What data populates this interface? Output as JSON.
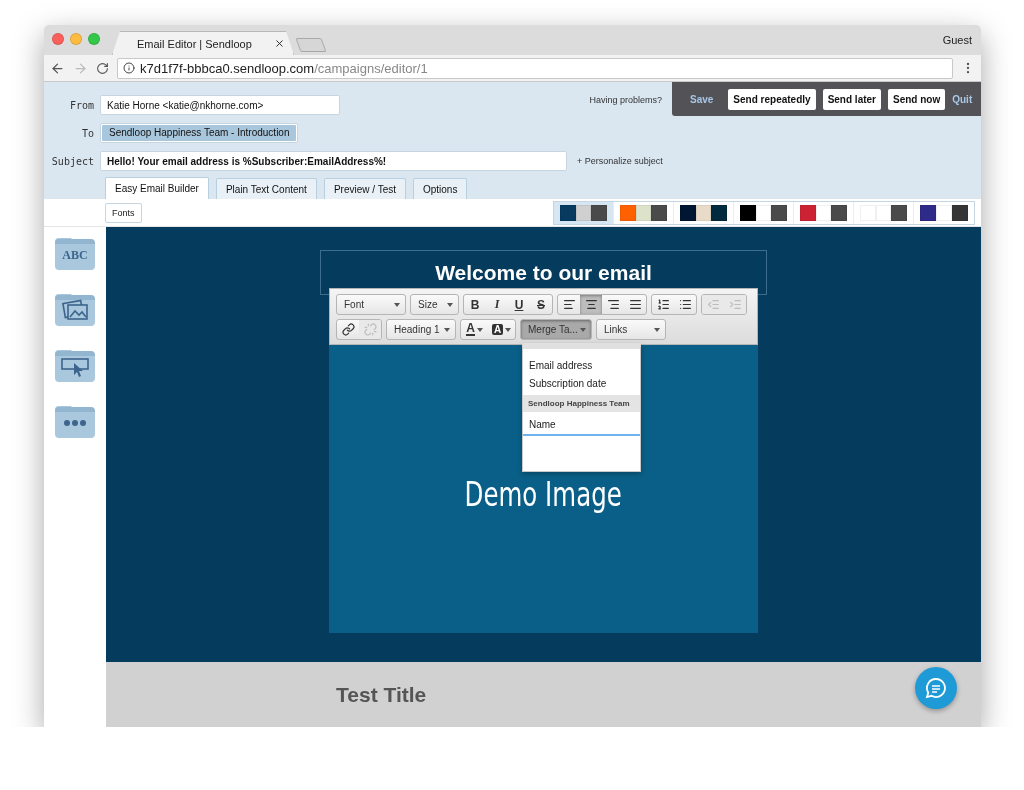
{
  "browser": {
    "tab_title": "Email Editor | Sendloop",
    "profile": "Guest",
    "url_host": "k7d1f7f-bbbca0.sendloop.com",
    "url_path": "/campaigns/editor/1"
  },
  "header": {
    "fields": [
      {
        "label": "From",
        "kind": "text",
        "value": "Katie Horne <katie@nkhorne.com>"
      },
      {
        "label": "To",
        "kind": "chip",
        "value": "Sendloop Happiness Team - Introduction"
      },
      {
        "label": "Subject",
        "kind": "subject",
        "value": "Hello! Your email address is %Subscriber:EmailAddress%!",
        "link": "+ Personalize subject"
      }
    ],
    "help_link": "Having problems?",
    "actions": [
      {
        "label": "Save",
        "kind": "link"
      },
      {
        "label": "Send repeatedly",
        "kind": "button"
      },
      {
        "label": "Send later",
        "kind": "button"
      },
      {
        "label": "Send now",
        "kind": "button"
      },
      {
        "label": "Quit",
        "kind": "link"
      }
    ],
    "tabs": [
      {
        "label": "Easy Email Builder",
        "selected": true
      },
      {
        "label": "Plain Text Content",
        "selected": false
      },
      {
        "label": "Preview / Test",
        "selected": false
      },
      {
        "label": "Options",
        "selected": false
      }
    ]
  },
  "toolbar": {
    "fonts_button": "Fonts",
    "palettes": [
      {
        "selected": true,
        "colors": [
          {
            "color": "#063a5e"
          },
          {
            "color": "#d0d0d0"
          },
          {
            "color": "#4a4a4a"
          }
        ]
      },
      {
        "selected": false,
        "colors": [
          {
            "color": "#ff6000"
          },
          {
            "color": "#dde3cb"
          },
          {
            "color": "#4a4a4a"
          }
        ]
      },
      {
        "selected": false,
        "colors": [
          {
            "color": "#001632"
          },
          {
            "color": "#e8dcc8"
          },
          {
            "color": "#002a3e"
          }
        ]
      },
      {
        "selected": false,
        "colors": [
          {
            "color": "#000000"
          },
          {
            "color": "#ffffff"
          },
          {
            "color": "#4a4a4a"
          }
        ]
      },
      {
        "selected": false,
        "colors": [
          {
            "color": "#cc2233"
          },
          {
            "color": "#ffffff"
          },
          {
            "color": "#4a4a4a"
          }
        ]
      },
      {
        "selected": false,
        "colors": [
          {
            "color": "#ffffff"
          },
          {
            "color": "#ffffff"
          },
          {
            "color": "#4a4a4a"
          }
        ]
      },
      {
        "selected": false,
        "colors": [
          {
            "color": "#2e2a8a"
          },
          {
            "color": "#ffffff"
          },
          {
            "color": "#353535"
          }
        ]
      }
    ]
  },
  "sidebar": [
    {
      "kind": "text",
      "label": "ABC"
    },
    {
      "kind": "image"
    },
    {
      "kind": "button"
    },
    {
      "kind": "more"
    }
  ],
  "editor": {
    "title": "Welcome to our email",
    "image_text": "Demo Image",
    "toolbar_rows": [
      [
        {
          "kind": "dropdown",
          "label": "Font",
          "active": false
        },
        {
          "kind": "dropdown",
          "label": "Size",
          "active": false
        },
        {
          "kind": "group",
          "buttons": [
            {
              "kind": "bold",
              "label": "B",
              "selected": false
            },
            {
              "kind": "italic",
              "label": "I",
              "selected": false
            },
            {
              "kind": "underline",
              "label": "U",
              "selected": false
            },
            {
              "kind": "strike",
              "label": "S",
              "selected": false
            }
          ]
        },
        {
          "kind": "group",
          "buttons": [
            {
              "kind": "align-left",
              "selected": false
            },
            {
              "kind": "align-center",
              "selected": true
            },
            {
              "kind": "align-right",
              "selected": false
            },
            {
              "kind": "align-justify",
              "selected": false
            }
          ]
        },
        {
          "kind": "group",
          "buttons": [
            {
              "kind": "ordered-list",
              "selected": false
            },
            {
              "kind": "bullet-list",
              "selected": false
            }
          ]
        },
        {
          "kind": "group",
          "buttons": [
            {
              "kind": "outdent",
              "disabled": true
            },
            {
              "kind": "indent",
              "disabled": true
            }
          ]
        }
      ],
      [
        {
          "kind": "group",
          "buttons": [
            {
              "kind": "link",
              "disabled": false
            },
            {
              "kind": "unlink",
              "disabled": true
            }
          ]
        },
        {
          "kind": "dropdown",
          "label": "Heading 1",
          "active": false
        },
        {
          "kind": "group",
          "buttons": [
            {
              "kind": "text-color",
              "label": "A"
            },
            {
              "kind": "bg-color",
              "label": "A"
            }
          ]
        },
        {
          "kind": "dropdown",
          "label": "Merge Ta...",
          "active": true
        },
        {
          "kind": "dropdown",
          "label": "Links",
          "active": false
        }
      ]
    ],
    "dropdown": {
      "items": [
        {
          "kind": "item",
          "label": "Email address",
          "selected": false
        },
        {
          "kind": "item",
          "label": "Subscription date",
          "selected": false
        },
        {
          "kind": "header",
          "label": "Sendloop Happiness Team"
        },
        {
          "kind": "item",
          "label": "Name",
          "selected": true
        }
      ]
    }
  },
  "footer": {
    "title": "Test Title"
  }
}
